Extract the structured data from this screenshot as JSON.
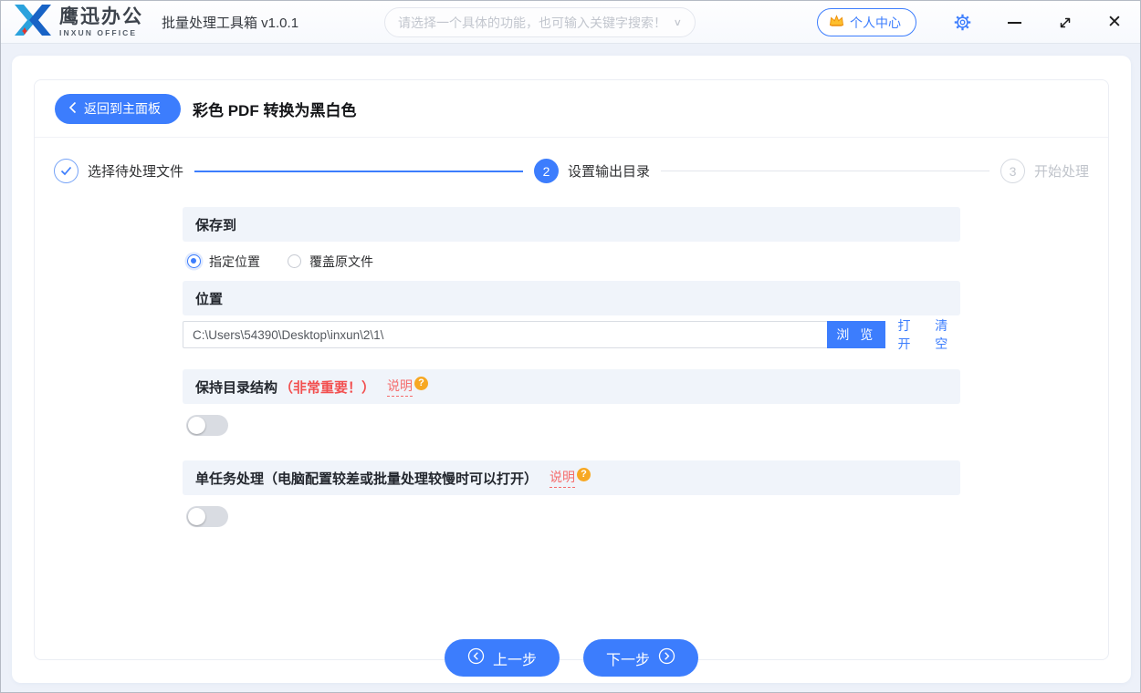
{
  "colors": {
    "primary": "#3c7dfd",
    "red": "#f24f4f",
    "help_red": "#f56c6c",
    "badge_orange": "#f7a823"
  },
  "titlebar": {
    "logo_cn": "鹰迅办公",
    "logo_en": "INXUN OFFICE",
    "app_title": "批量处理工具箱 v1.0.1",
    "search_placeholder": "请选择一个具体的功能，也可输入关键字搜索！",
    "user_center": "个人中心"
  },
  "toolbar": {
    "back_label": "返回到主面板",
    "page_title": "彩色 PDF 转换为黑白色"
  },
  "steps": [
    {
      "label": "选择待处理文件",
      "state": "done"
    },
    {
      "num": "2",
      "label": "设置输出目录",
      "state": "active"
    },
    {
      "num": "3",
      "label": "开始处理",
      "state": "pending"
    }
  ],
  "form": {
    "save_to": {
      "header": "保存到",
      "options": [
        {
          "label": "指定位置",
          "selected": true
        },
        {
          "label": "覆盖原文件",
          "selected": false
        }
      ]
    },
    "location": {
      "header": "位置",
      "path": "C:\\Users\\54390\\Desktop\\inxun\\2\\1\\",
      "browse": "浏 览",
      "open": "打开",
      "clear": "清空"
    },
    "keep_structure": {
      "label": "保持目录结构",
      "warning": "（非常重要！）",
      "help": "说明",
      "enabled": false
    },
    "single_task": {
      "label": "单任务处理（电脑配置较差或批量处理较慢时可以打开）",
      "help": "说明",
      "enabled": false
    }
  },
  "footer": {
    "prev": "上一步",
    "next": "下一步"
  }
}
